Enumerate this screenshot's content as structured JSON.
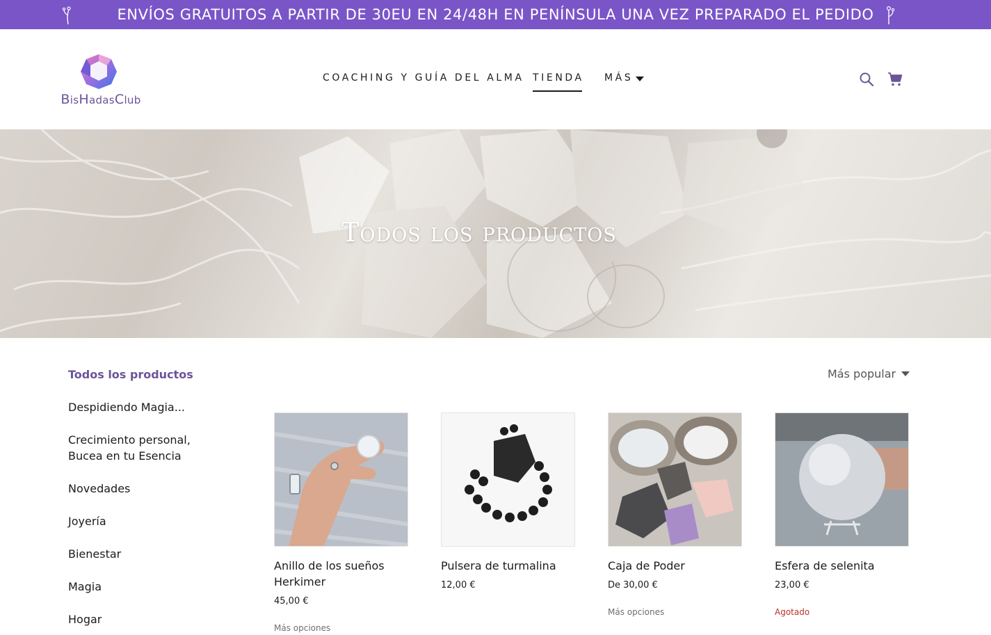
{
  "promo": {
    "text": "ENVÍOS GRATUITOS A PARTIR DE 30EU EN 24/48H EN PENÍNSULA UNA VEZ PREPARADO EL PEDIDO"
  },
  "logo": {
    "text_1": "B",
    "text_2": "is",
    "text_3": "H",
    "text_4": "adas",
    "text_5": "C",
    "text_6": "lub"
  },
  "nav": {
    "items": [
      {
        "label": "Coaching y guía del alma"
      },
      {
        "label": "Tienda"
      },
      {
        "label": "Más"
      }
    ]
  },
  "hero": {
    "title": "Todos los productos"
  },
  "sidebar": {
    "categories": [
      {
        "label": "Todos los productos"
      },
      {
        "label": "Despidiendo Magia..."
      },
      {
        "label": "Crecimiento personal, Bucea en tu Esencia"
      },
      {
        "label": "Novedades"
      },
      {
        "label": "Joyería"
      },
      {
        "label": "Bienestar"
      },
      {
        "label": "Magia"
      },
      {
        "label": "Hogar"
      }
    ]
  },
  "sort": {
    "label": "Más popular"
  },
  "products": [
    {
      "name": "Anillo de los sueños Herkimer",
      "price": "45,00 €",
      "extra": "Más opciones"
    },
    {
      "name": "Pulsera de turmalina",
      "price": "12,00 €",
      "extra": ""
    },
    {
      "name": "Caja de Poder",
      "price": "De   30,00 €",
      "extra": "Más opciones"
    },
    {
      "name": "Esfera de selenita",
      "price": "23,00 €",
      "extra": "Agotado"
    }
  ],
  "colors": {
    "accent": "#7a55c8",
    "brand": "#6b5499",
    "sold_out": "#b8332c"
  }
}
